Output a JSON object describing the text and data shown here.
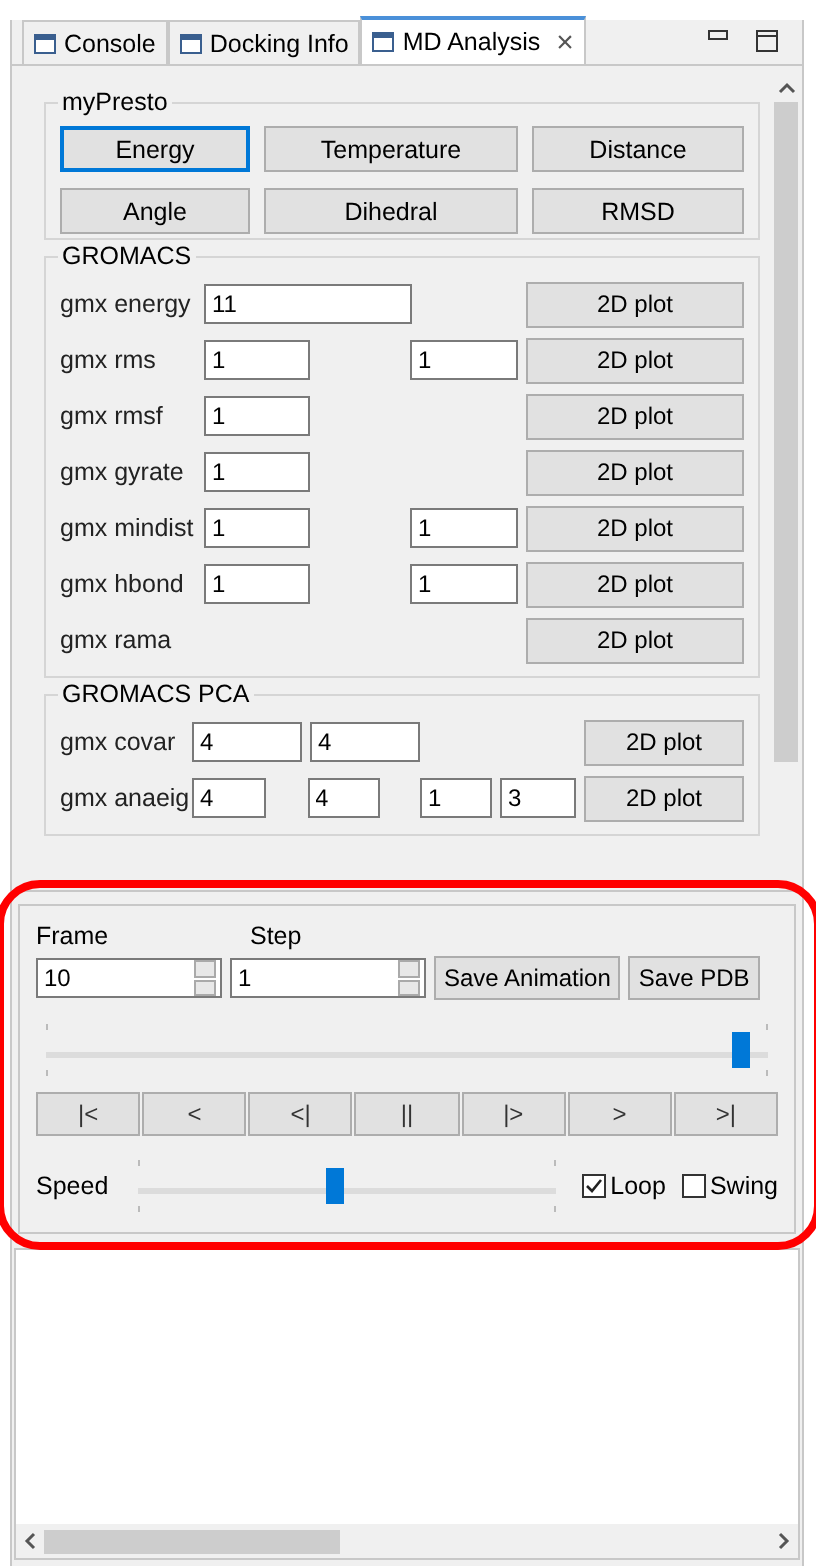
{
  "tabs": [
    {
      "label": "Console",
      "selected": false
    },
    {
      "label": "Docking Info",
      "selected": false
    },
    {
      "label": "MD Analysis",
      "selected": true,
      "close": "×"
    }
  ],
  "mypresto": {
    "title": "myPresto",
    "buttons": [
      {
        "label": "Energy",
        "focused": true
      },
      {
        "label": "Temperature",
        "focused": false
      },
      {
        "label": "Distance",
        "focused": false
      },
      {
        "label": "Angle",
        "focused": false
      },
      {
        "label": "Dihedral",
        "focused": false
      },
      {
        "label": "RMSD",
        "focused": false
      }
    ]
  },
  "gromacs": {
    "title": "GROMACS",
    "rows": [
      {
        "label": "gmx energy",
        "kind": "wide",
        "fields": [
          "11"
        ],
        "button": "2D plot"
      },
      {
        "label": "gmx rms",
        "kind": "pair",
        "fields": [
          "1",
          "1"
        ],
        "button": "2D plot"
      },
      {
        "label": "gmx rmsf",
        "kind": "single",
        "fields": [
          "1"
        ],
        "button": "2D plot"
      },
      {
        "label": "gmx gyrate",
        "kind": "single",
        "fields": [
          "1"
        ],
        "button": "2D plot"
      },
      {
        "label": "gmx mindist",
        "kind": "pair",
        "fields": [
          "1",
          "1"
        ],
        "button": "2D plot"
      },
      {
        "label": "gmx hbond",
        "kind": "pair",
        "fields": [
          "1",
          "1"
        ],
        "button": "2D plot"
      },
      {
        "label": "gmx rama",
        "kind": "none",
        "fields": [],
        "button": "2D plot"
      }
    ]
  },
  "gromacs_pca": {
    "title": "GROMACS PCA",
    "rows": [
      {
        "label": "gmx covar",
        "kind": "two",
        "fields": [
          "4",
          "4"
        ],
        "button": "2D plot"
      },
      {
        "label": "gmx anaeig",
        "kind": "four",
        "fields": [
          "4",
          "4",
          "1",
          "3"
        ],
        "button": "2D plot"
      }
    ]
  },
  "animation": {
    "frame": {
      "label": "Frame",
      "value": "10"
    },
    "step": {
      "label": "Step",
      "value": "1"
    },
    "buttons": [
      "Save Animation",
      "Save PDB"
    ],
    "frame_slider": {
      "level": 0.96
    },
    "transport": [
      "|<",
      "<",
      "<|",
      "||",
      "|>",
      ">",
      ">|"
    ],
    "speed": {
      "label": "Speed",
      "level": 0.47
    },
    "options": [
      {
        "label": "Loop",
        "checked": true
      },
      {
        "label": "Swing",
        "checked": false
      }
    ],
    "highlighted": true
  }
}
